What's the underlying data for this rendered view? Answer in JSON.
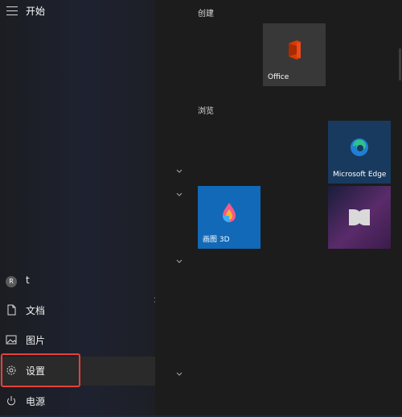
{
  "header": {
    "title": "开始"
  },
  "user": {
    "initial": "R",
    "name": "t"
  },
  "rail": {
    "documents": "文档",
    "pictures": "图片",
    "settings": "设置",
    "power": "电源"
  },
  "groups": {
    "create": "创建",
    "browse": "浏览"
  },
  "tiles": {
    "office": {
      "label": "Office",
      "color": "#3a3a3a"
    },
    "edge": {
      "label": "Microsoft Edge",
      "color": "#1b3a5c"
    },
    "paint3d": {
      "label": "画图 3D",
      "color": "#1169b7"
    },
    "dolby": {
      "label": "",
      "color": "#4a2a5e"
    }
  },
  "accents": {
    "highlight": "#e8403a"
  }
}
